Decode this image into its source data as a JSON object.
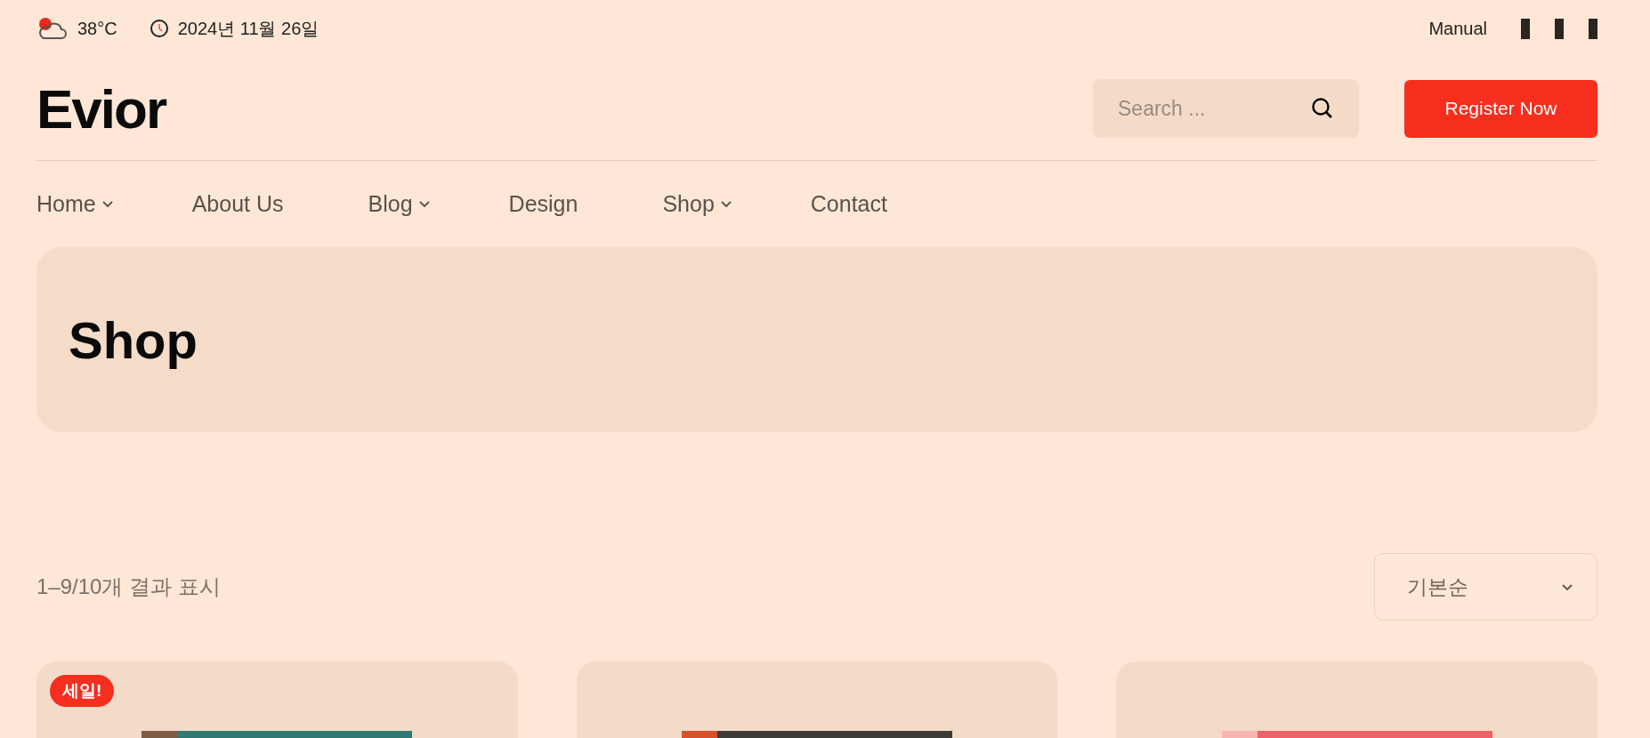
{
  "topbar": {
    "temperature": "38°C",
    "date": "2024년 11월 26일",
    "manual": "Manual"
  },
  "logo": "Evior",
  "search": {
    "placeholder": "Search ..."
  },
  "register_button": "Register Now",
  "nav": [
    {
      "label": "Home",
      "has_menu": true
    },
    {
      "label": "About Us",
      "has_menu": false
    },
    {
      "label": "Blog",
      "has_menu": true
    },
    {
      "label": "Design",
      "has_menu": false
    },
    {
      "label": "Shop",
      "has_menu": true
    },
    {
      "label": "Contact",
      "has_menu": false
    }
  ],
  "page_title": "Shop",
  "result_count": "1–9/10개 결과 표시",
  "sort": {
    "value": "기본순"
  },
  "products": [
    {
      "sale_badge": "세일!",
      "kind": "picture"
    },
    {
      "kind": "picture"
    },
    {
      "kind": "picture"
    }
  ]
}
